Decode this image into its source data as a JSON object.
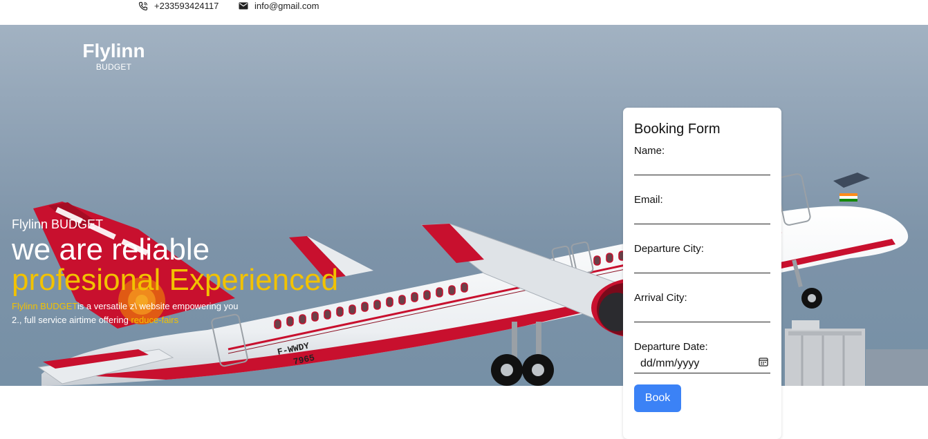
{
  "contact": {
    "phone": "+233593424117",
    "email": "info@gmail.com"
  },
  "logo": {
    "name": "Flylinn",
    "tagline": "BUDGET"
  },
  "hero": {
    "brand": "Flylinn BUDGET",
    "headline_1": "we are reliable",
    "headline_2": "profesional Experienced",
    "desc_highlight_1": "Flylinn BUDGET",
    "desc_text_1": "is a versatile z\\ website empowering you",
    "desc_text_2": "2., full service airtime offering ",
    "desc_highlight_2": "reduce-fairs"
  },
  "booking_form": {
    "title": "Booking Form",
    "name_label": "Name:",
    "email_label": "Email:",
    "departure_city_label": "Departure City:",
    "arrival_city_label": "Arrival City:",
    "departure_date_label": "Departure Date:",
    "date_placeholder": "dd/mm/yyyy",
    "submit_label": "Book"
  },
  "aircraft": {
    "registration": "F-WWDY",
    "msn": "7965"
  },
  "colors": {
    "accent_yellow": "#f2c200",
    "button_blue": "#3b82f6",
    "livery_red": "#c8102e"
  }
}
